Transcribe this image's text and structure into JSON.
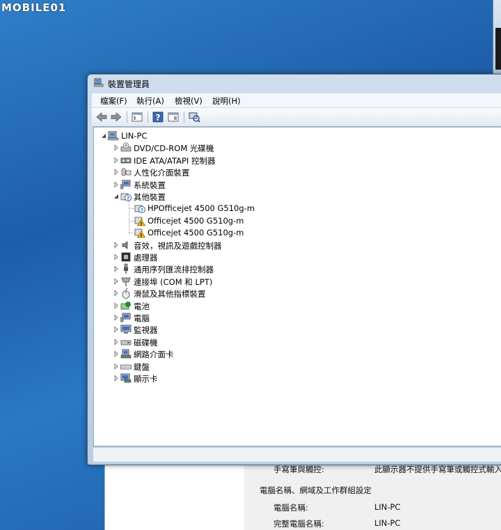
{
  "watermark": {
    "text": "MOBILE01"
  },
  "window": {
    "title": "裝置管理員"
  },
  "menu": [
    "檔案(F)",
    "執行(A)",
    "檢視(V)",
    "說明(H)"
  ],
  "tree": {
    "root": "LIN-PC",
    "items": [
      {
        "label": "DVD/CD-ROM 光碟機",
        "icon": "dvd-drive-icon"
      },
      {
        "label": "IDE ATA/ATAPI 控制器",
        "icon": "ide-controller-icon"
      },
      {
        "label": "人性化介面裝置",
        "icon": "hid-icon"
      },
      {
        "label": "系統裝置",
        "icon": "system-device-icon"
      },
      {
        "label": "其他裝置",
        "icon": "other-device-icon",
        "expanded": true,
        "children": [
          {
            "label": "HPOfficejet 4500 G510g-m",
            "icon": "unknown-device-icon"
          },
          {
            "label": "Officejet 4500 G510g-m",
            "icon": "warning-device-icon"
          },
          {
            "label": "Officejet 4500 G510g-m",
            "icon": "warning-device-icon"
          }
        ]
      },
      {
        "label": "音效，視訊及遊戲控制器",
        "icon": "speaker-icon"
      },
      {
        "label": "處理器",
        "icon": "processor-icon"
      },
      {
        "label": "通用序列匯流排控制器",
        "icon": "usb-icon"
      },
      {
        "label": "連接埠 (COM 和 LPT)",
        "icon": "port-icon"
      },
      {
        "label": "滑鼠及其他指標裝置",
        "icon": "mouse-icon"
      },
      {
        "label": "電池",
        "icon": "battery-icon"
      },
      {
        "label": "電腦",
        "icon": "computer-icon"
      },
      {
        "label": "監視器",
        "icon": "monitor-icon"
      },
      {
        "label": "磁碟機",
        "icon": "disk-drive-icon"
      },
      {
        "label": "網路介面卡",
        "icon": "network-adapter-icon"
      },
      {
        "label": "鍵盤",
        "icon": "keyboard-icon"
      },
      {
        "label": "顯示卡",
        "icon": "display-adapter-icon"
      }
    ]
  },
  "background": {
    "touch_label": "手寫筆與觸控:",
    "touch_value": "此顯示器不提供手寫筆或觸控式輸入",
    "section_title": "電腦名稱、網域及工作群組設定",
    "computer_name_label": "電腦名稱:",
    "computer_name_value": "LIN-PC",
    "full_name_label": "完整電腦名稱:",
    "full_name_value": "LIN-PC"
  },
  "colors": {
    "desktop": "#1d5ea8",
    "title_bar": "#c3d5ea"
  }
}
